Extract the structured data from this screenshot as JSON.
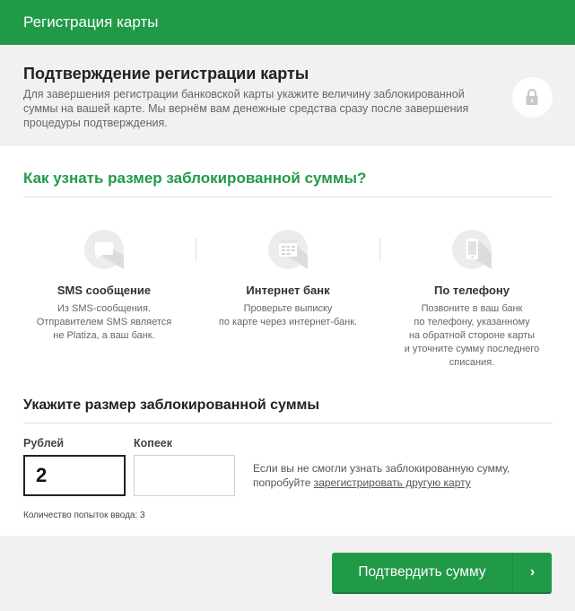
{
  "header": {
    "title": "Регистрация карты"
  },
  "confirm": {
    "title": "Подтверждение регистрации карты",
    "text": "Для завершения регистрации банковской карты укажите величину заблокированной суммы на вашей карте. Мы вернём вам денежные средства сразу после завершения процедуры подтверждения.",
    "icon": "lock-icon"
  },
  "how_to": {
    "title": "Как узнать размер заблокированной суммы?",
    "methods": [
      {
        "icon": "sms-bubble-icon",
        "title": "SMS сообщение",
        "text": "Из SMS-сообщения.\nОтправителем SMS является\nне Platiza, а ваш банк."
      },
      {
        "icon": "internet-bank-icon",
        "title": "Интернет банк",
        "text": "Проверьте выписку\nпо карте через интернет-банк."
      },
      {
        "icon": "phone-icon",
        "title": "По телефону",
        "text": "Позвоните в ваш банк\nпо телефону, указанному\nна обратной стороне карты\nи уточните сумму последнего\nсписания."
      }
    ]
  },
  "amount": {
    "title": "Укажите размер заблокированной суммы",
    "rubles_label": "Рублей",
    "rubles_value": "2",
    "kopecks_label": "Копеек",
    "kopecks_value": "",
    "hint_prefix": "Если вы не смогли узнать заблокированную сумму, попробуйте ",
    "hint_link": "зарегистрировать другую карту",
    "attempts": "Количество попыток ввода: 3"
  },
  "footer": {
    "submit_label": "Подтвердить сумму",
    "arrow": "›"
  },
  "colors": {
    "accent": "#219a48",
    "panel": "#f1f1f1"
  }
}
